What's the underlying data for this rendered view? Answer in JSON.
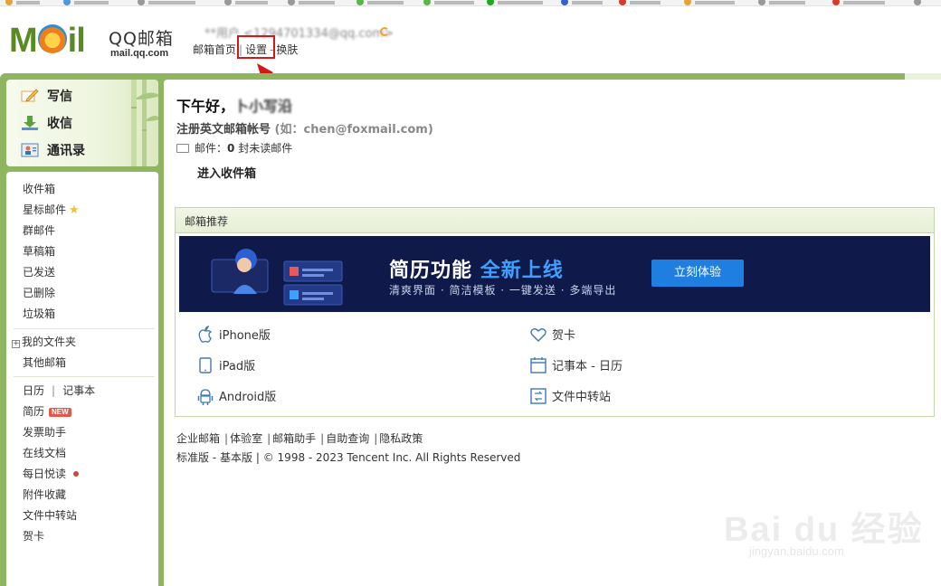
{
  "header": {
    "logo_text": "MOil",
    "brand_name": "QQ邮箱",
    "brand_domain": "mail.qq.com",
    "account": "**用户 <1294701334@qq.com>",
    "nav": {
      "home": "邮箱首页",
      "settings": "设置",
      "skin": "换肤",
      "sep": "|",
      "sep2": "-"
    }
  },
  "compose": {
    "write": "写信",
    "receive": "收信",
    "contacts": "通讯录"
  },
  "folders": {
    "inbox": "收件箱",
    "starred": "星标邮件",
    "group": "群邮件",
    "drafts": "草稿箱",
    "sent": "已发送",
    "deleted": "已删除",
    "spam": "垃圾箱",
    "my_folders": "我的文件夹",
    "other_mailboxes": "其他邮箱",
    "calendar": "日历",
    "calendar_sep": "|",
    "notebook": "记事本",
    "resume": "简历",
    "new_badge": "NEW",
    "invoice": "发票助手",
    "docs": "在线文档",
    "daily_read": "每日悦读",
    "attachments": "附件收藏",
    "file_transfer": "文件中转站",
    "greeting_card": "贺卡"
  },
  "main": {
    "greeting_prefix": "下午好，",
    "greeting_name": "卜小写沿",
    "register_label": "注册英文邮箱帐号",
    "register_example": "(如：chen@foxmail.com)",
    "mail_label": "邮件：",
    "unread_count": "0",
    "unread_suffix": "封未读邮件",
    "inbox_link": "进入收件箱"
  },
  "recommend": {
    "title": "邮箱推荐",
    "banner_title_a": "简历功能",
    "banner_title_b": "全新上线",
    "banner_sub": "清爽界面 · 简洁模板 · 一键发送 · 多端导出",
    "banner_button": "立刻体验",
    "apps": {
      "iphone": "iPhone版",
      "ipad": "iPad版",
      "android": "Android版",
      "card": "贺卡",
      "notebook": "记事本 - 日历",
      "transfer": "文件中转站"
    }
  },
  "footer": {
    "links": [
      "企业邮箱",
      "体验室",
      "邮箱助手",
      "自助查询",
      "隐私政策"
    ],
    "sep": "|",
    "standard": "标准版",
    "dash": "-",
    "basic": "基本版",
    "copyright": "© 1998 - 2023 Tencent Inc. All Rights Reserved"
  },
  "watermark": {
    "text": "Bai du 经验",
    "sub": "jingyan.baidu.com"
  },
  "colors": {
    "frame_green": "#8fb561",
    "brand_green": "#5a8a23",
    "banner_navy": "#0f1a4a",
    "banner_blue": "#1f7fe0",
    "highlight_red": "#d01a1a",
    "new_badge": "#e15a4e"
  },
  "icons": {
    "write": "pencil-icon",
    "receive": "download-icon",
    "contacts": "address-book-icon",
    "envelope": "envelope-icon",
    "iphone": "apple-icon",
    "ipad": "tablet-icon",
    "android": "android-icon",
    "card": "heart-icon",
    "notebook": "calendar-icon",
    "transfer": "file-transfer-icon"
  }
}
